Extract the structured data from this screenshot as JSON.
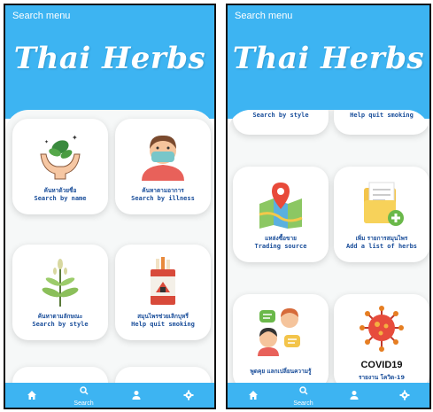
{
  "header": {
    "menu_label": "Search menu",
    "app_title": "Thai Herbs"
  },
  "left_screen": {
    "cards": [
      {
        "thai": "ค้นหาด้วยชื่อ",
        "english": "Search by name",
        "icon": "herb-hands-icon"
      },
      {
        "thai": "ค้นหาตามอาการ",
        "english": "Search by illness",
        "icon": "masked-person-icon"
      },
      {
        "thai": "ค้นหาตามลักษณะ",
        "english": "Search by style",
        "icon": "plant-icon"
      },
      {
        "thai": "สมุนไพรช่วยเลิกบุหรี่",
        "english": "Help quit smoking",
        "icon": "cigarette-pack-icon"
      }
    ]
  },
  "right_screen": {
    "partial_labels": [
      "Search by style",
      "Help quit smoking"
    ],
    "cards": [
      {
        "thai": "แหล่งซื้อขาย",
        "english": "Trading source",
        "icon": "map-pin-icon"
      },
      {
        "thai": "เพิ่ม รายการสมุนไพร",
        "english": "Add a list of herbs",
        "icon": "add-folder-icon"
      },
      {
        "thai": "พูดคุย แลกเปลี่ยนความรู้",
        "english": "",
        "icon": "chat-people-icon"
      },
      {
        "covid_title": "COVID19",
        "thai": "รายงาน โควิด-19",
        "icon": "virus-icon"
      }
    ]
  },
  "nav": {
    "search_label": "Search"
  },
  "colors": {
    "header_blue": "#3db4f2",
    "label_blue": "#1a4e9a"
  }
}
